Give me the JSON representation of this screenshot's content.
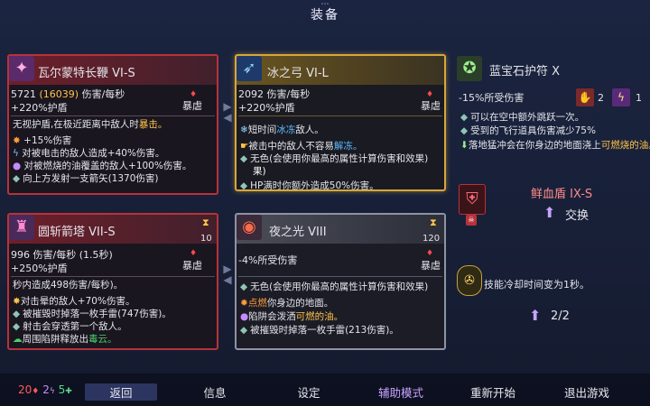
{
  "header": {
    "title": "装备"
  },
  "cards": {
    "whip": {
      "name": "瓦尔蒙特长鞭 VI-S",
      "dps": "5721",
      "dps_alt": "(16039)",
      "dps_unit": "伤害/每秒",
      "bonus": "+220%护盾",
      "tag": "暴虐",
      "line1_a": "无视护盾,在极近距离中敌人时",
      "line1_b": "暴击。",
      "lines": [
        "+15%伤害",
        "对被电击的敌人造成+40%伤害。",
        "对被燃烧的油覆盖的敌人+100%伤害。",
        "向上方发射一支箭矢(1370伤害)"
      ]
    },
    "bow": {
      "name": "冰之弓 VI-L",
      "dps": "2092",
      "dps_unit": "伤害/每秒",
      "bonus": "+220%护盾",
      "tag": "暴虐",
      "line1_a": "短时间",
      "line1_b": "冰冻",
      "line1_c": "敌人。",
      "line2_a": "被击中的敌人不容易",
      "line2_b": "解冻。",
      "line3": "无色(会使用你最高的属性计算伤害和效果)",
      "line4": "HP满时你额外造成50%伤害。"
    },
    "talisman": {
      "name": "蓝宝石护符 X",
      "stat": "-15%所受伤害",
      "badge1": "2",
      "badge2": "1",
      "lines": [
        "可以在空中额外跳跃一次。",
        "受到的飞行道具伤害减少75%"
      ],
      "line3_a": "落地猛冲会在你身边的地面浇上",
      "line3_b": "可燃烧的油。"
    },
    "turret": {
      "name": "圆斩箭塔 VII-S",
      "cooldown": "10",
      "dps": "996",
      "dps_unit": "伤害/每秒 (1.5秒)",
      "bonus": "+250%护盾",
      "tag": "暴虐",
      "line1": "秒内造成498伤害/每秒)。",
      "lines": [
        "对击晕的敌人+70%伤害。",
        "被摧毁时掉落一枚手雷(747伤害)。",
        "射击会穿透第一个敌人。"
      ],
      "line5_a": "周围陷阱",
      "line5_b": "释放出",
      "line5_c": "毒云。"
    },
    "night": {
      "name": "夜之光 VIII",
      "cooldown": "120",
      "stat": "-4%所受伤害",
      "tag": "暴虐",
      "line1": "无色(会使用你最高的属性计算伤害和效果)",
      "line2_a": "点燃",
      "line2_b": "你身边的地面。",
      "line3_a": "陷阱会泼洒",
      "line3_b": "可燃的油。",
      "line4": "被摧毁时掉落一枚手雷(213伤害)。"
    },
    "shield": {
      "name": "鲜血盾 IX-S",
      "swap": "交换"
    },
    "amulet": {
      "text": "技能冷却时间变为1秒。",
      "count": "2/2"
    }
  },
  "footer": {
    "stats": {
      "brutality": "20",
      "tactics": "2",
      "survival": "5"
    },
    "buttons": [
      "返回",
      "信息",
      "设定",
      "辅助模式",
      "重新开始",
      "退出游戏"
    ]
  },
  "colors": {
    "red_frame": "#b8323a",
    "gold_frame": "#d7a63a",
    "grey_frame": "#8e93a3",
    "highlight": "#d7a63a",
    "ice": "#5ab8ff",
    "fire": "#ff9c3a",
    "poison": "#4bd06a",
    "assist": "#c7a3ff"
  }
}
